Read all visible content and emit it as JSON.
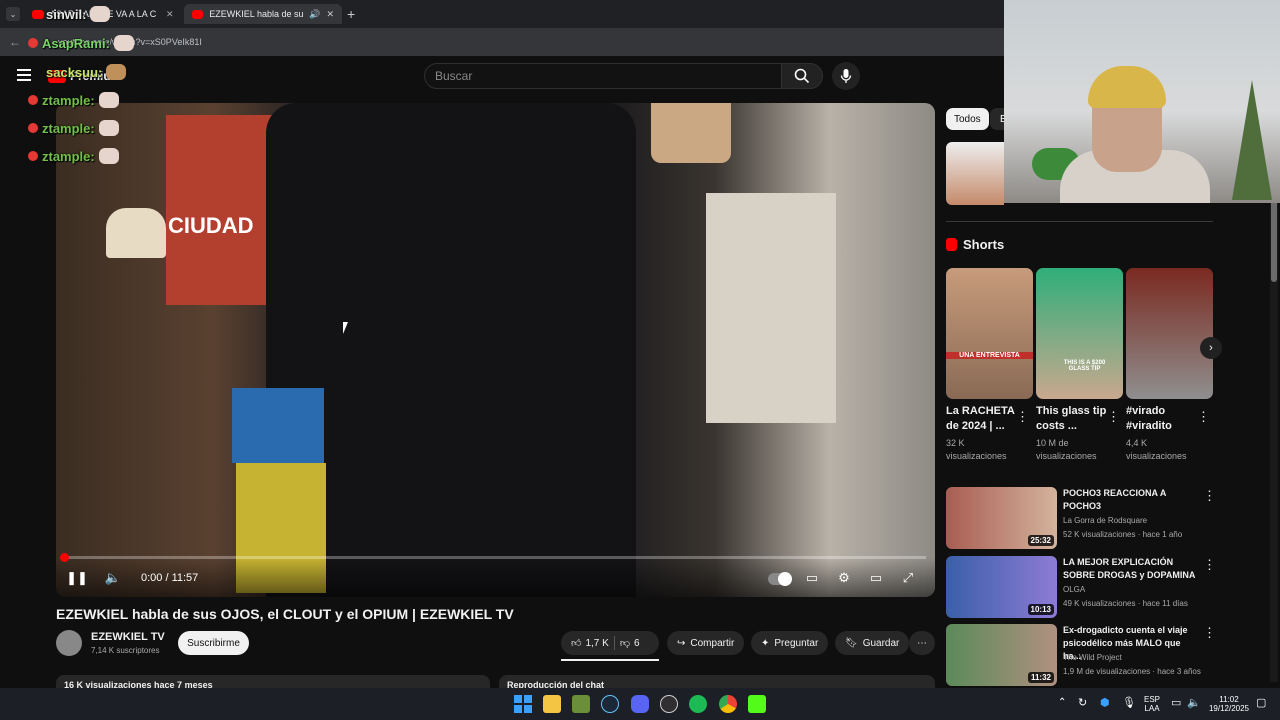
{
  "browser": {
    "tabs": [
      {
        "title": "ASAP RAMI SE VA A LA C"
      },
      {
        "title": "EZEWKIEL habla de sus OJO"
      }
    ],
    "url": "youtube.com/watch?v=xS0PVeIk81I"
  },
  "yt_header": {
    "logo_label": "Premium",
    "search_placeholder": "Buscar"
  },
  "player": {
    "time": "0:00 / 11:57",
    "progress": 0.0
  },
  "video_overlay_text": {
    "poster": "CIUDAD"
  },
  "video": {
    "title": "EZEWKIEL habla de sus OJOS, el CLOUT y el OPIUM | EZEWKIEL TV",
    "channel": "EZEWKIEL TV",
    "subscribers": "7,14 K suscriptores",
    "subscribe_label": "Suscribirme",
    "likes": "1,7 K",
    "dislikes": "6",
    "share_label": "Compartir",
    "ask_label": "Preguntar",
    "save_label": "Guardar",
    "description_peek": "16 K visualizaciones  hace 7 meses",
    "chat_replay_label": "Reproducción del chat"
  },
  "chips": {
    "all": "Todos",
    "second": "E"
  },
  "shorts": {
    "heading": "Shorts",
    "items": [
      {
        "title": "La RACHETA de 2024 | ...",
        "views": "32 K visualizaciones",
        "overlay": "UNA ENTREVISTA",
        "color": "#b98a6c"
      },
      {
        "title": "This glass tip costs ...",
        "views": "10 M de visualizaciones",
        "overlay": "THIS IS A $200 GLASS TIP",
        "color": "#2fae79"
      },
      {
        "title": "#virado #viradito",
        "views": "4,4 K visualizaciones",
        "overlay": "",
        "color": "#7a5b56"
      }
    ]
  },
  "recommendations": [
    {
      "title": "POCHO3 REACCIONA A POCHO3",
      "channel": "La Gorra de Rodsquare",
      "meta": "52 K visualizaciones · hace 1 año",
      "duration": "25:32",
      "color": "#a85d52"
    },
    {
      "title": "LA MEJOR EXPLICACIÓN SOBRE DROGAS y DOPAMINA",
      "channel": "OLGA",
      "meta": "49 K visualizaciones · hace 11 días",
      "duration": "10:13",
      "color": "#3a5fa8"
    },
    {
      "title": "Ex-drogadicto cuenta el viaje psicodélico más MALO que ha...",
      "channel": "The Wild Project",
      "meta": "1,9 M de visualizaciones · hace 3 años",
      "duration": "11:32",
      "color": "#5b8a5a"
    }
  ],
  "chat": [
    {
      "user": "sinwil:"
    },
    {
      "user": "AsapRami:"
    },
    {
      "user": "sacksuu:"
    },
    {
      "user": "ztample:"
    },
    {
      "user": "ztample:"
    },
    {
      "user": "ztample:"
    }
  ],
  "tray": {
    "lang": "ESP",
    "layout": "LAA",
    "time": "11:02",
    "date": "19/12/2025"
  }
}
